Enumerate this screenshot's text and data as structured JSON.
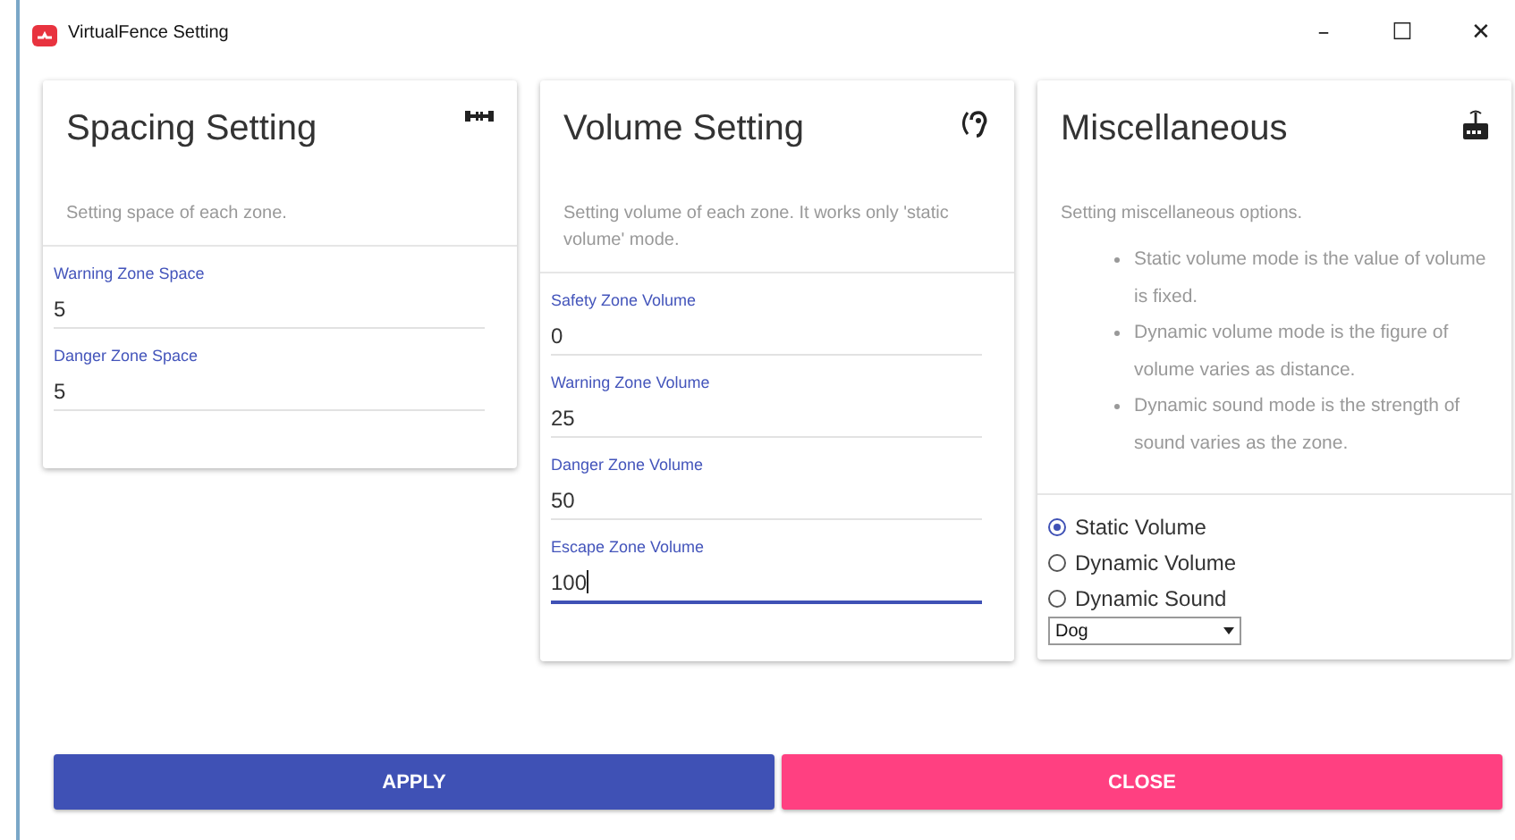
{
  "window": {
    "title": "VirtualFence Setting",
    "controls": [
      "–",
      "☐",
      "✕"
    ]
  },
  "cards": [
    {
      "title": "Spacing Setting",
      "description": "Setting space of each zone.",
      "fields": [
        {
          "label": "Warning Zone Space",
          "value": "5",
          "focused": false
        },
        {
          "label": "Danger Zone Space",
          "value": "5",
          "focused": false
        }
      ]
    },
    {
      "title": "Volume Setting",
      "description": "Setting volume of each zone. It works only 'static volume' mode.",
      "fields": [
        {
          "label": "Safety Zone Volume",
          "value": "0",
          "focused": false
        },
        {
          "label": "Warning Zone Volume",
          "value": "25",
          "focused": false
        },
        {
          "label": "Danger Zone Volume",
          "value": "50",
          "focused": false
        },
        {
          "label": "Escape Zone Volume",
          "value": "100",
          "focused": true
        }
      ]
    },
    {
      "title": "Miscellaneous",
      "description": "Setting miscellaneous options.",
      "notes": [
        "Static volume mode is the value of volume is fixed.",
        "Dynamic volume mode is the figure of volume varies as distance.",
        "Dynamic sound mode is the strength of sound varies as the zone."
      ],
      "modes": [
        {
          "label": "Static Volume",
          "selected": true
        },
        {
          "label": "Dynamic Volume",
          "selected": false
        },
        {
          "label": "Dynamic Sound",
          "selected": false
        }
      ],
      "dropdown": {
        "value": "Dog"
      }
    }
  ],
  "buttons": [
    {
      "label": "APPLY",
      "kind": "primary"
    },
    {
      "label": "CLOSE",
      "kind": "danger"
    }
  ]
}
